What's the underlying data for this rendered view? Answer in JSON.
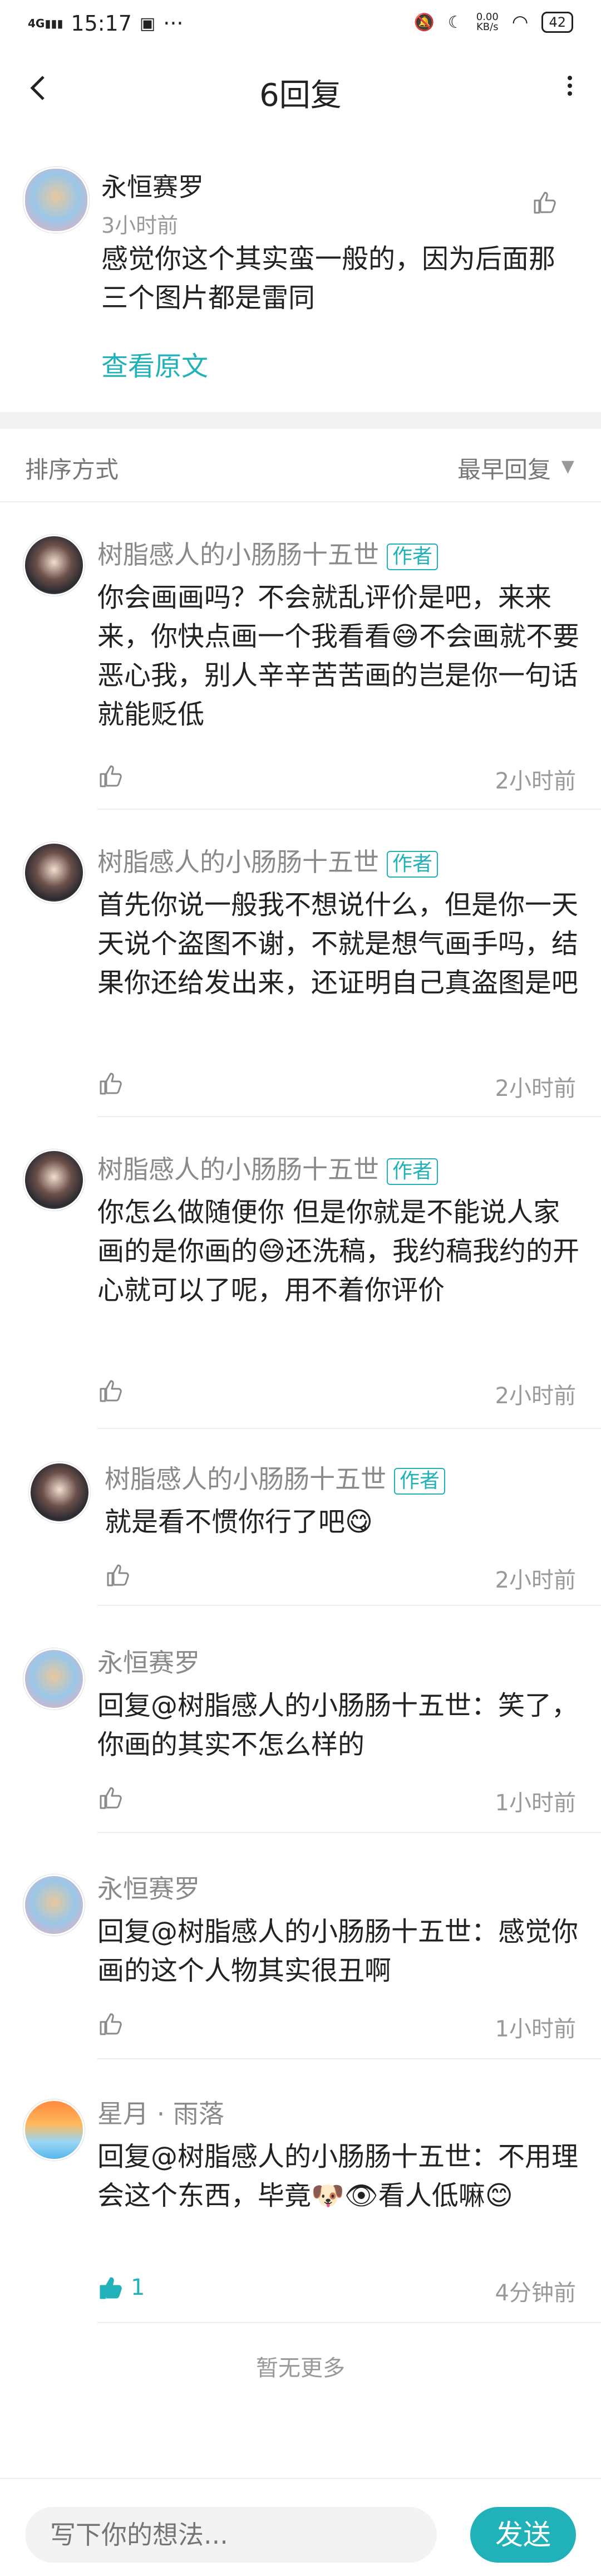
{
  "status_bar": {
    "time": "15:17",
    "network": "4G",
    "speed_value": "0.00",
    "speed_unit": "KB/s",
    "battery": "42",
    "more": "···"
  },
  "header": {
    "title": "6回复"
  },
  "main_post": {
    "author": "永恒赛罗",
    "time": "3小时前",
    "content": "感觉你这个其实蛮一般的，因为后面那三个图片都是雷同",
    "view_original": "查看原文"
  },
  "sort": {
    "label": "排序方式",
    "value": "最早回复"
  },
  "replies": [
    {
      "author": "树脂感人的小肠肠十五世",
      "tag": "作者",
      "content": "你会画画吗？不会就乱评价是吧，来来来，你快点画一个我看看😅不会画就不要恶心我，别人辛辛苦苦画的岂是你一句话就能贬低",
      "time": "2小时前"
    },
    {
      "author": "树脂感人的小肠肠十五世",
      "tag": "作者",
      "content": "首先你说一般我不想说什么，但是你一天天说个盗图不谢，不就是想气画手吗，结果你还给发出来，还证明自己真盗图是吧",
      "time": "2小时前"
    },
    {
      "author": "树脂感人的小肠肠十五世",
      "tag": "作者",
      "content": "你怎么做随便你 但是你就是不能说人家画的是你画的😅还洗稿，我约稿我约的开心就可以了呢，用不着你评价",
      "time": "2小时前"
    },
    {
      "author": "树脂感人的小肠肠十五世",
      "tag": "作者",
      "content": "就是看不惯你行了吧😋",
      "time": "2小时前"
    },
    {
      "author": "永恒赛罗",
      "content": "回复@树脂感人的小肠肠十五世：笑了，你画的其实不怎么样的",
      "time": "1小时前"
    },
    {
      "author": "永恒赛罗",
      "content": "回复@树脂感人的小肠肠十五世：感觉你画的这个人物其实很丑啊",
      "time": "1小时前"
    },
    {
      "author": "星月 · 雨落",
      "content": "回复@树脂感人的小肠肠十五世：不用理会这个东西，毕竟🐶👁看人低嘛😊",
      "time": "4分钟前",
      "likes": "1"
    }
  ],
  "footer": {
    "no_more": "暂无更多"
  },
  "bottom_bar": {
    "placeholder": "写下你的想法...",
    "send": "发送"
  },
  "colors": {
    "accent": "#21b2b9",
    "text": "#222222",
    "muted": "#999999"
  },
  "icons": [
    "back-arrow-icon",
    "more-vertical-icon",
    "thumbs-up-icon",
    "dropdown-caret-icon",
    "signal-icon",
    "wifi-icon",
    "battery-icon",
    "mute-icon",
    "moon-icon"
  ]
}
